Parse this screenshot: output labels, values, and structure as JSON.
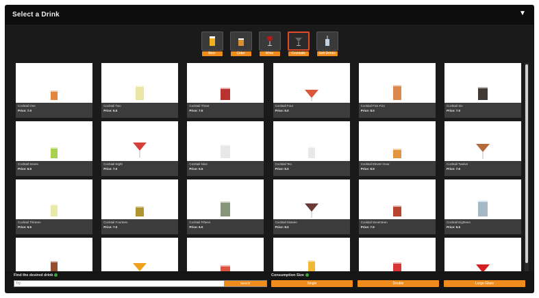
{
  "dialog": {
    "title": "Select a Drink"
  },
  "categories": [
    {
      "label": "Beer",
      "selected": false
    },
    {
      "label": "Cider",
      "selected": false
    },
    {
      "label": "Wine",
      "selected": false
    },
    {
      "label": "Cocktails",
      "selected": true
    },
    {
      "label": "Soft Drinks",
      "selected": false
    }
  ],
  "drinks": [
    {
      "name": "Cocktail One",
      "price": "Price: 7.0"
    },
    {
      "name": "Cocktail Two",
      "price": "Price: 6.5"
    },
    {
      "name": "Cocktail Three",
      "price": "Price: 7.5"
    },
    {
      "name": "Cocktail Four",
      "price": "Price: 6.0"
    },
    {
      "name": "Cocktail Five Fizz",
      "price": "Price: 8.0"
    },
    {
      "name": "Cocktail Six",
      "price": "Price: 7.0"
    },
    {
      "name": "Cocktail Seven",
      "price": "Price: 6.5"
    },
    {
      "name": "Cocktail Eight",
      "price": "Price: 7.0"
    },
    {
      "name": "Cocktail Nine",
      "price": "Price: 5.5"
    },
    {
      "name": "Cocktail Ten",
      "price": "Price: 6.0"
    },
    {
      "name": "Cocktail Eleven Sour",
      "price": "Price: 8.5"
    },
    {
      "name": "Cocktail Twelve",
      "price": "Price: 7.5"
    },
    {
      "name": "Cocktail Thirteen",
      "price": "Price: 6.5"
    },
    {
      "name": "Cocktail Fourteen",
      "price": "Price: 7.0"
    },
    {
      "name": "Cocktail Fifteen",
      "price": "Price: 6.0"
    },
    {
      "name": "Cocktail Sixteen",
      "price": "Price: 8.0"
    },
    {
      "name": "Cocktail Seventeen",
      "price": "Price: 7.5"
    },
    {
      "name": "Cocktail Eighteen",
      "price": "Price: 6.5"
    },
    {
      "name": "",
      "price": ""
    },
    {
      "name": "",
      "price": ""
    },
    {
      "name": "",
      "price": ""
    },
    {
      "name": "",
      "price": ""
    },
    {
      "name": "",
      "price": ""
    },
    {
      "name": "",
      "price": ""
    }
  ],
  "drink_colors": [
    "#e07a2a",
    "#e8e39a",
    "#b01d16",
    "#d9573a",
    "#d87a3a",
    "#2b241f",
    "#9ecc3a",
    "#d6403a",
    "#e6e6e6",
    "#e6e6e6",
    "#e08a2a",
    "#b46a3a",
    "#e6e6a0",
    "#a6881a",
    "#7a8a6a",
    "#6a3a3a",
    "#b0301a",
    "#9ab0c0",
    "#8a3a1a",
    "#f0a01a",
    "#d8402a",
    "#f0b020",
    "#d42020",
    "#d42020"
  ],
  "footer": {
    "search_label": "Find the desired drink",
    "search_placeholder": "Try",
    "search_button": "Search",
    "consume_label": "Consumption Size",
    "consume_options": [
      "Single",
      "Double",
      "Large Glass"
    ]
  }
}
